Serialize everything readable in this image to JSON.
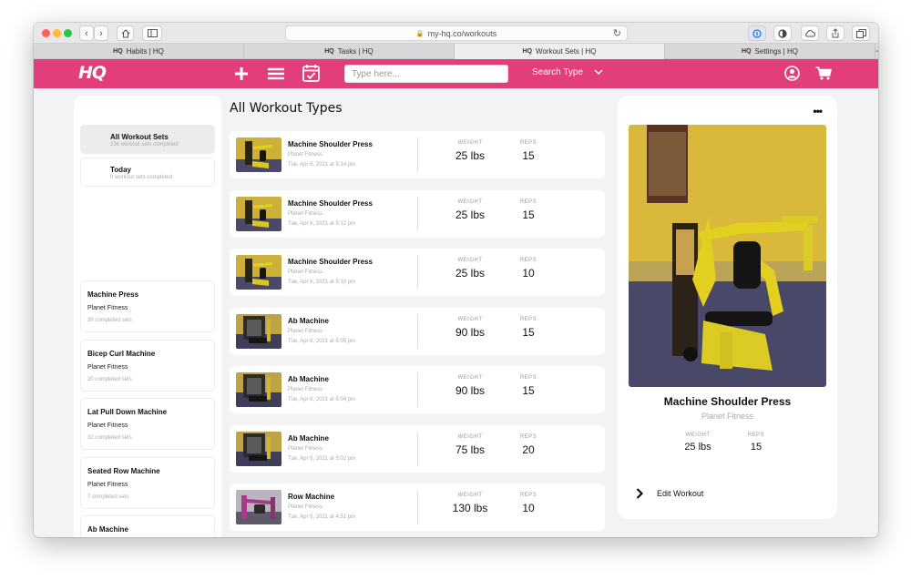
{
  "browser": {
    "url": "my-hq.co/workouts",
    "tabs": [
      {
        "favicon": "HQ",
        "label": "Habits | HQ"
      },
      {
        "favicon": "HQ",
        "label": "Tasks | HQ"
      },
      {
        "favicon": "HQ",
        "label": "Workout Sets | HQ",
        "active": true
      },
      {
        "favicon": "HQ",
        "label": "Settings | HQ"
      }
    ]
  },
  "header": {
    "logo": "HQ",
    "search_placeholder": "Type here...",
    "search_type_label": "Search Type",
    "brand_color": "#e23e7b"
  },
  "sidebar": {
    "filters": [
      {
        "title": "All Workout Sets",
        "subtitle": "236 workout sets completed"
      },
      {
        "title": "Today",
        "subtitle": "0 workout sets completed"
      }
    ],
    "machines": [
      {
        "name": "Machine Press",
        "gym": "Planet Fitness",
        "count": "39 completed sets"
      },
      {
        "name": "Bicep Curl Machine",
        "gym": "Planet Fitness",
        "count": "20 completed sets"
      },
      {
        "name": "Lat Pull Down Machine",
        "gym": "Planet Fitness",
        "count": "32 completed sets"
      },
      {
        "name": "Seated Row Machine",
        "gym": "Planet Fitness",
        "count": "7 completed sets"
      },
      {
        "name": "Ab Machine",
        "gym": "",
        "count": ""
      }
    ]
  },
  "main": {
    "heading": "All Workout Types",
    "weight_label": "WEIGHT",
    "reps_label": "REPS",
    "sets": [
      {
        "name": "Machine Shoulder Press",
        "gym": "Planet Fitness",
        "date": "Tue, Apr 6, 2021 at 5:14 pm",
        "weight": "25 lbs",
        "reps": "15",
        "thumb": "yellow"
      },
      {
        "name": "Machine Shoulder Press",
        "gym": "Planet Fitness",
        "date": "Tue, Apr 6, 2021 at 5:12 pm",
        "weight": "25 lbs",
        "reps": "15",
        "thumb": "yellow"
      },
      {
        "name": "Machine Shoulder Press",
        "gym": "Planet Fitness",
        "date": "Tue, Apr 6, 2021 at 5:10 pm",
        "weight": "25 lbs",
        "reps": "10",
        "thumb": "yellow"
      },
      {
        "name": "Ab Machine",
        "gym": "Planet Fitness",
        "date": "Tue, Apr 6, 2021 at 5:05 pm",
        "weight": "90 lbs",
        "reps": "15",
        "thumb": "dark"
      },
      {
        "name": "Ab Machine",
        "gym": "Planet Fitness",
        "date": "Tue, Apr 6, 2021 at 5:04 pm",
        "weight": "90 lbs",
        "reps": "15",
        "thumb": "dark"
      },
      {
        "name": "Ab Machine",
        "gym": "Planet Fitness",
        "date": "Tue, Apr 6, 2021 at 5:02 pm",
        "weight": "75 lbs",
        "reps": "20",
        "thumb": "dark"
      },
      {
        "name": "Row Machine",
        "gym": "Planet Fitness",
        "date": "Tue, Apr 6, 2021 at 4:51 pm",
        "weight": "130 lbs",
        "reps": "10",
        "thumb": "purple"
      }
    ]
  },
  "detail": {
    "more_label": "•••",
    "name": "Machine Shoulder Press",
    "gym": "Planet Fitness",
    "weight_label": "WEIGHT",
    "weight": "25 lbs",
    "reps_label": "REPS",
    "reps": "15",
    "edit_label": "Edit Workout"
  }
}
